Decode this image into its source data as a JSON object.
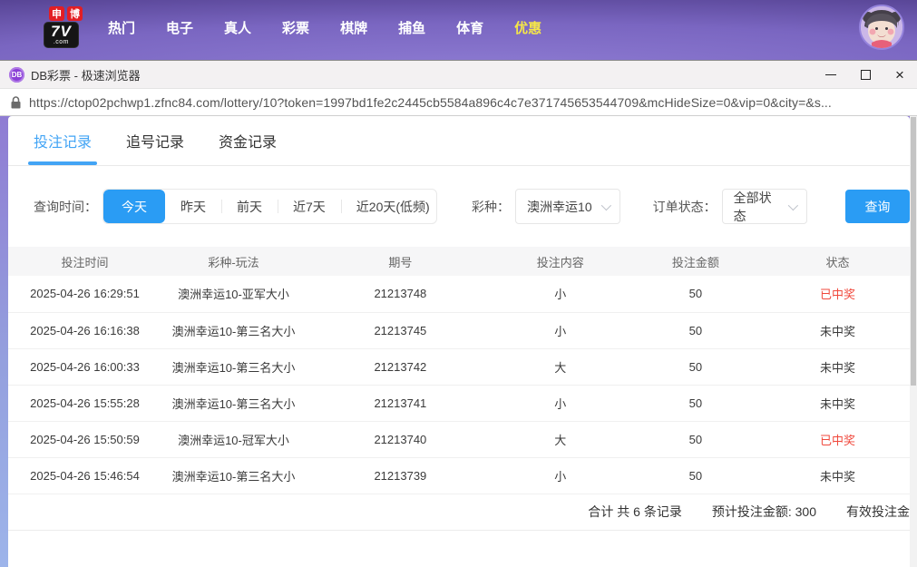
{
  "colors": {
    "accent_blue": "#2a9cf4",
    "tab_active_blue": "#42a4f5",
    "win_red": "#f0483c",
    "header_purple": "#7a66c1",
    "promo_yellow": "#f5e648"
  },
  "site_header": {
    "logo": {
      "badge1": "申",
      "badge2": "博",
      "main": "7V",
      "suffix": ".com"
    },
    "nav": [
      {
        "label": "热门"
      },
      {
        "label": "电子"
      },
      {
        "label": "真人"
      },
      {
        "label": "彩票"
      },
      {
        "label": "棋牌"
      },
      {
        "label": "捕鱼"
      },
      {
        "label": "体育"
      },
      {
        "label": "优惠"
      }
    ]
  },
  "browser": {
    "window_title": "DB彩票 - 极速浏览器",
    "tab_icon_text": "DB",
    "url": "https://ctop02pchwp1.zfnc84.com/lottery/10?token=1997bd1fe2c2445cb5584a896c4c7e371745653544709&mcHideSize=0&vip=0&city=&s...",
    "icons": {
      "lock": "lock-icon",
      "minimize": "minimize-icon",
      "maximize": "maximize-icon",
      "close": "close-icon",
      "close_glyph": "×"
    }
  },
  "page_tabs": [
    {
      "label": "投注记录",
      "active": true
    },
    {
      "label": "追号记录",
      "active": false
    },
    {
      "label": "资金记录",
      "active": false
    }
  ],
  "filters": {
    "time_label": "查询时间：",
    "time_options": [
      {
        "label": "今天",
        "active": true
      },
      {
        "label": "昨天",
        "active": false
      },
      {
        "label": "前天",
        "active": false
      },
      {
        "label": "近7天",
        "active": false
      },
      {
        "label": "近20天(低频)",
        "active": false
      }
    ],
    "lottery_label": "彩种：",
    "lottery_value": "澳洲幸运10",
    "status_label": "订单状态：",
    "status_value": "全部状态",
    "search_button": "查询"
  },
  "table": {
    "columns": [
      "投注时间",
      "彩种-玩法",
      "期号",
      "投注内容",
      "投注金额",
      "状态"
    ],
    "rows": [
      {
        "time": "2025-04-26 16:29:51",
        "play": "澳洲幸运10-亚军大小",
        "issue": "21213748",
        "content": "小",
        "amount": "50",
        "status": "已中奖",
        "won": true
      },
      {
        "time": "2025-04-26 16:16:38",
        "play": "澳洲幸运10-第三名大小",
        "issue": "21213745",
        "content": "小",
        "amount": "50",
        "status": "未中奖",
        "won": false
      },
      {
        "time": "2025-04-26 16:00:33",
        "play": "澳洲幸运10-第三名大小",
        "issue": "21213742",
        "content": "大",
        "amount": "50",
        "status": "未中奖",
        "won": false
      },
      {
        "time": "2025-04-26 15:55:28",
        "play": "澳洲幸运10-第三名大小",
        "issue": "21213741",
        "content": "小",
        "amount": "50",
        "status": "未中奖",
        "won": false
      },
      {
        "time": "2025-04-26 15:50:59",
        "play": "澳洲幸运10-冠军大小",
        "issue": "21213740",
        "content": "大",
        "amount": "50",
        "status": "已中奖",
        "won": true
      },
      {
        "time": "2025-04-26 15:46:54",
        "play": "澳洲幸运10-第三名大小",
        "issue": "21213739",
        "content": "小",
        "amount": "50",
        "status": "未中奖",
        "won": false
      }
    ],
    "summary": {
      "total": "合计 共 6 条记录",
      "expected": "预计投注金额: 300",
      "valid": "有效投注金"
    }
  }
}
